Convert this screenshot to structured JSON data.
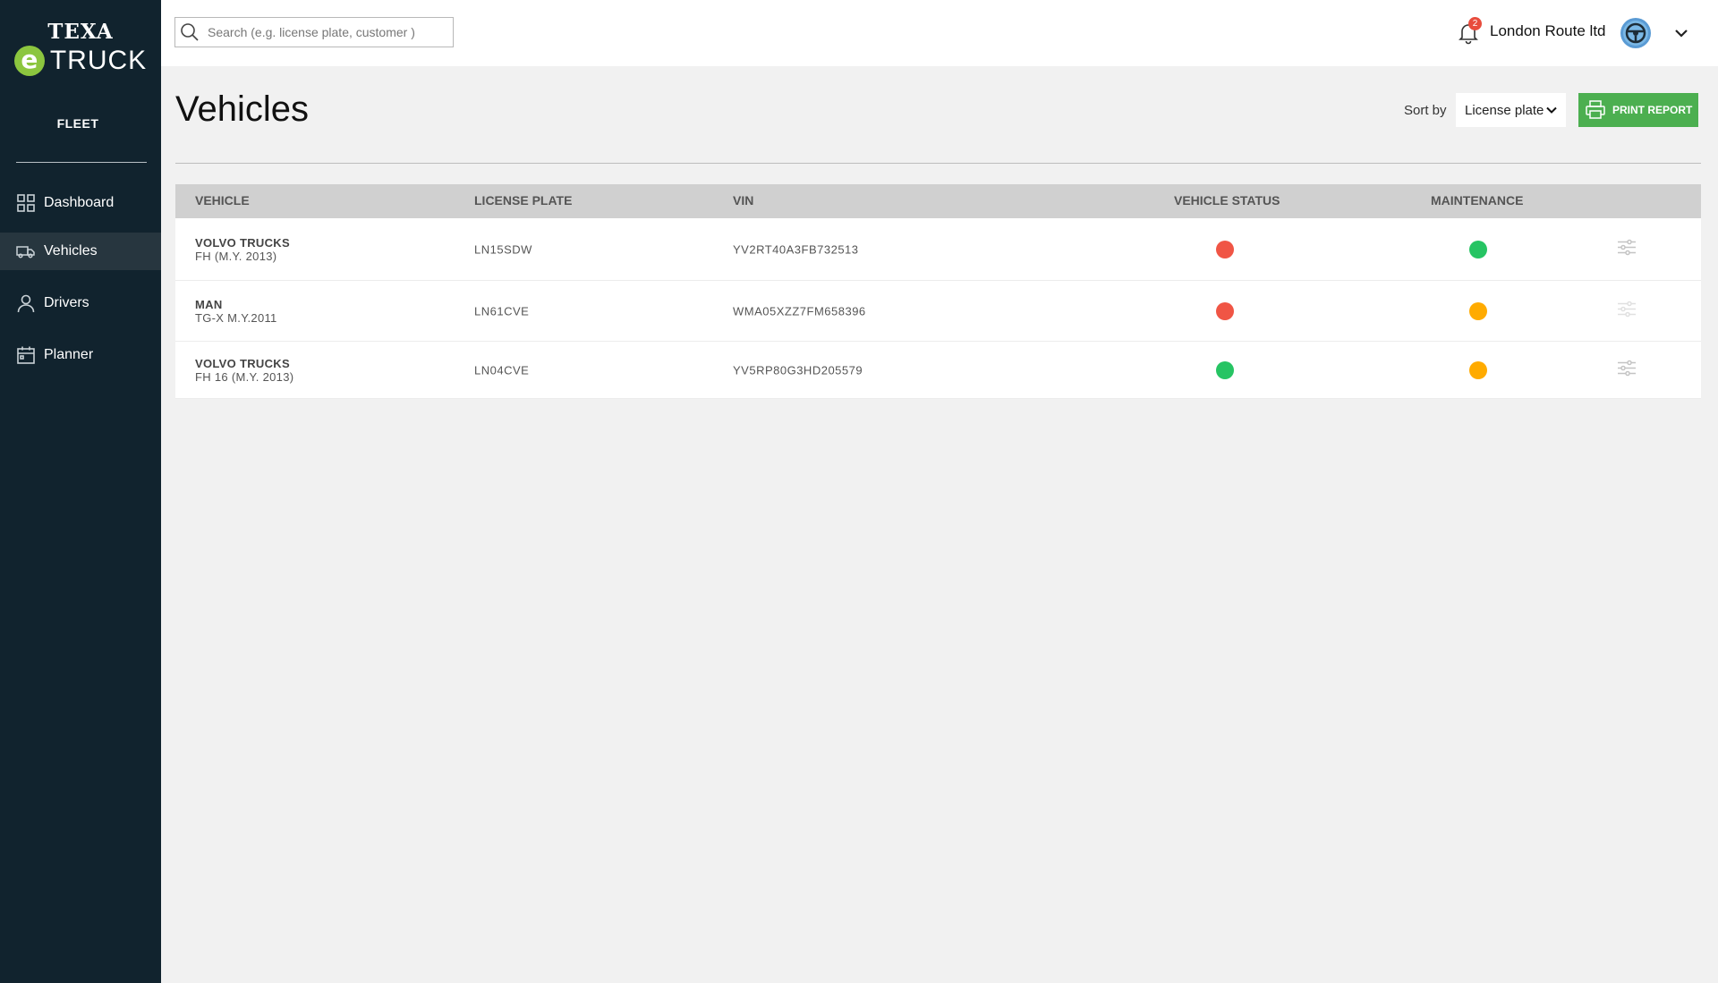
{
  "app": {
    "logo_top": "TEXA",
    "logo_letter": "e",
    "logo_bottom": "TRUCK",
    "section": "FLEET"
  },
  "nav": {
    "items": [
      {
        "label": "Dashboard",
        "icon": "dashboard-icon",
        "active": false
      },
      {
        "label": "Vehicles",
        "icon": "truck-icon",
        "active": true
      },
      {
        "label": "Drivers",
        "icon": "user-icon",
        "active": false
      },
      {
        "label": "Planner",
        "icon": "calendar-icon",
        "active": false
      }
    ]
  },
  "topbar": {
    "search_placeholder": "Search (e.g. license plate, customer )",
    "notification_count": "2",
    "company": "London Route ltd"
  },
  "page": {
    "title": "Vehicles",
    "sort_label": "Sort by",
    "sort_value": "License plate",
    "print_label": "PRINT REPORT"
  },
  "table": {
    "headers": {
      "vehicle": "VEHICLE",
      "plate": "LICENSE PLATE",
      "vin": "VIN",
      "status": "VEHICLE STATUS",
      "maintenance": "MAINTENANCE"
    },
    "rows": [
      {
        "make": "VOLVO TRUCKS",
        "model": "FH (M.Y. 2013)",
        "plate": "LN15SDW",
        "vin": "YV2RT40A3FB732513",
        "status": "red",
        "maintenance": "green"
      },
      {
        "make": "MAN",
        "model": "TG-X M.Y.2011",
        "plate": "LN61CVE",
        "vin": "WMA05XZZ7FM658396",
        "status": "red",
        "maintenance": "orange"
      },
      {
        "make": "VOLVO TRUCKS",
        "model": "FH 16 (M.Y. 2013)",
        "plate": "LN04CVE",
        "vin": "YV5RP80G3HD205579",
        "status": "green",
        "maintenance": "orange"
      }
    ]
  },
  "colors": {
    "sidebar": "#11232e",
    "accent": "#4caf50",
    "status_red": "#f05545",
    "status_green": "#26c463",
    "status_orange": "#ffab00"
  }
}
